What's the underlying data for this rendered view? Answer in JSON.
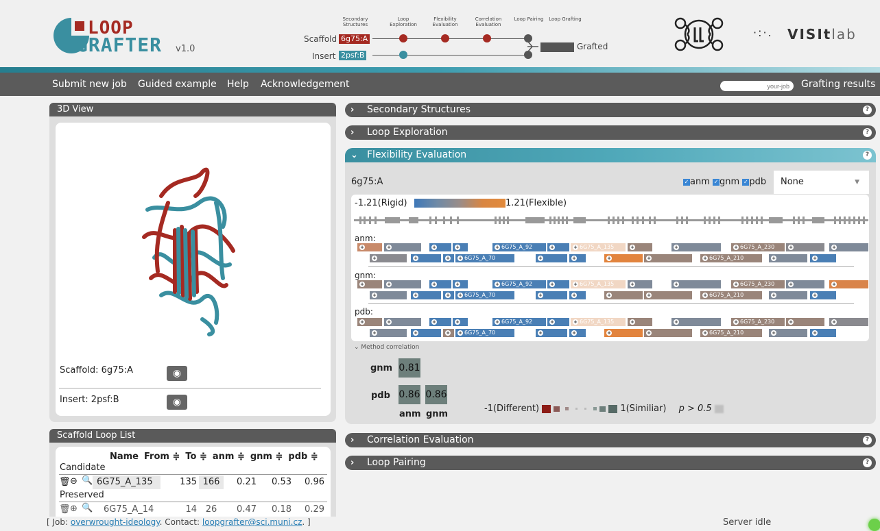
{
  "header": {
    "logo_top": "LOOP",
    "logo_bottom": "GRAFTER",
    "version": "v1.0",
    "pipeline_steps": [
      "Secondary Structures",
      "Loop Exploration",
      "Flexibility Evaluation",
      "Correlation Evaluation",
      "Loop Pairing",
      "Loop Grafting"
    ],
    "scaffold_label": "Scaffold",
    "scaffold_id": "6g75:A",
    "insert_label": "Insert",
    "insert_id": "2psf:B",
    "grafted_label": "Grafted",
    "visitlab_dots": "·:·.",
    "visitlab_bold": "VISIt",
    "visitlab_rest": "lab",
    "colors": {
      "scaffold": "#a52a22",
      "insert": "#3a8fa0"
    }
  },
  "nav": {
    "items": [
      "Submit new job",
      "Guided example",
      "Help",
      "Acknowledgement"
    ],
    "job_placeholder": "your-job",
    "results": "Grafting results"
  },
  "view3d": {
    "title": "3D View",
    "scaffold": "Scaffold: 6g75:A",
    "insert": "Insert: 2psf:B"
  },
  "loop_list": {
    "title": "Scaffold Loop List",
    "columns": [
      "Name",
      "From ≑",
      "To ≑",
      "anm ≑",
      "gnm ≑",
      "pdb ≑"
    ],
    "group_candidate": "Candidate",
    "group_preserved": "Preserved",
    "rows": [
      {
        "name": "6G75_A_135",
        "from": "135",
        "to": "166",
        "anm": "0.21",
        "gnm": "0.53",
        "pdb": "0.96"
      },
      {
        "name": "6G75_A_14",
        "from": "14",
        "to": "26",
        "anm": "0.47",
        "gnm": "0.18",
        "pdb": "0.29"
      }
    ]
  },
  "sections": {
    "secondary": "Secondary Structures",
    "loop_exploration": "Loop Exploration",
    "flexibility": "Flexibility Evaluation",
    "correlation": "Correlation Evaluation",
    "pairing": "Loop Pairing"
  },
  "flex": {
    "chain": "6g75:A",
    "checks": [
      "anm",
      "gnm",
      "pdb"
    ],
    "select_value": "None",
    "scale_min": "-1.21(Rigid)",
    "scale_max": "1.21(Flexible)",
    "methods": [
      "anm:",
      "gnm:",
      "pdb:"
    ],
    "loop_labels": {
      "l92": "6G75_A_92",
      "l135": "6G75_A_135",
      "l230": "6G75_A_230",
      "l70": "6G75_A_70",
      "l210": "6G75_A_210"
    },
    "method_corr_label": "Method correlation",
    "corr": {
      "rows": [
        "gnm",
        "pdb"
      ],
      "cols": [
        "anm",
        "gnm"
      ],
      "gnm_anm": "0.81",
      "pdb_anm": "0.86",
      "pdb_gnm": "0.86"
    },
    "corr_legend_left": "-1(Different)",
    "corr_legend_right": "1(Similiar)",
    "p_value": "p > 0.5"
  },
  "footer": {
    "prefix": "[ Job: ",
    "job": "overwrought-ideology",
    "contact": ". Contact: ",
    "email": "loopgrafter@sci.muni.cz",
    "suffix": ". ]",
    "status": "Server idle"
  }
}
